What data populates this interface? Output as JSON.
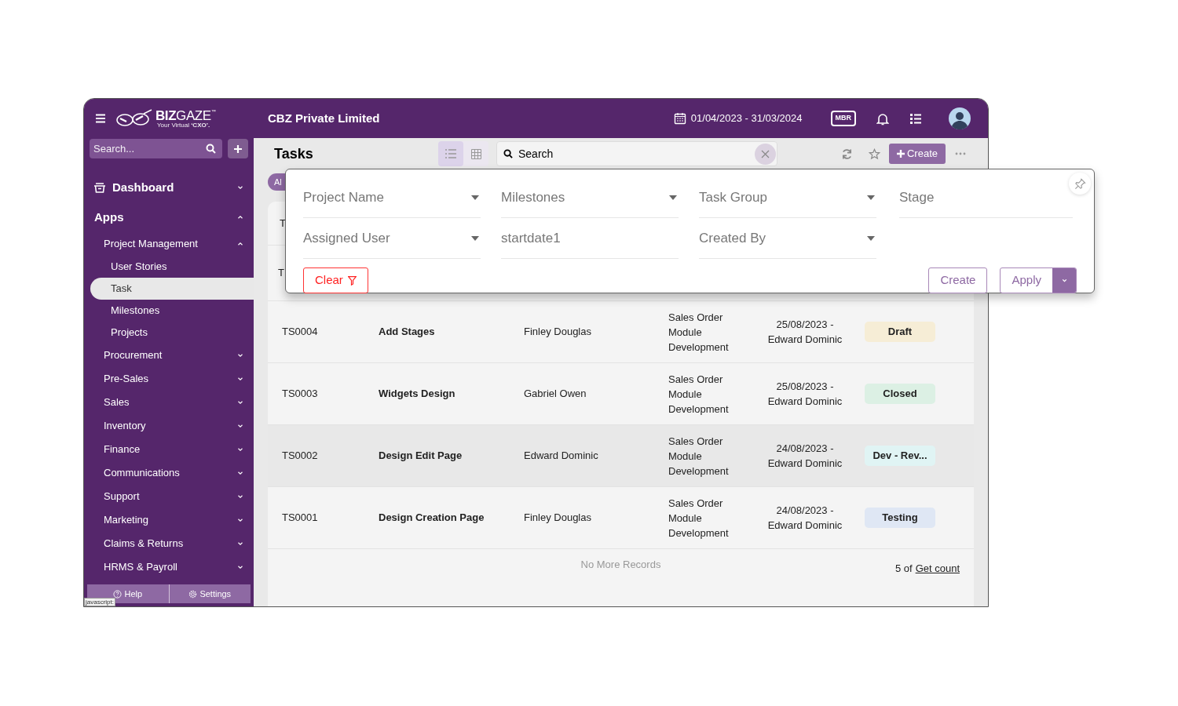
{
  "header": {
    "logo": {
      "brand": "**BIZ**GAZE",
      "trademark": "™",
      "tagline": "Your Virtual **‘CXO’.**"
    },
    "company": "CBZ Private Limited",
    "date_range": "01/04/2023 - 31/03/2024",
    "badge": "MBR"
  },
  "sidebar": {
    "search": {
      "placeholder": "Search..."
    },
    "items": [
      {
        "label": "Dashboard",
        "kind": "section",
        "expanded": false,
        "selected": false
      },
      {
        "label": "Apps",
        "kind": "heading",
        "expanded": true,
        "selected": false,
        "children": [
          {
            "label": "Project Management",
            "kind": "group",
            "expanded": true,
            "selected": false,
            "children": [
              {
                "label": "User Stories",
                "kind": "leaf",
                "selected": false
              },
              {
                "label": "Task",
                "kind": "leaf",
                "selected": true
              },
              {
                "label": "Milestones",
                "kind": "leaf",
                "selected": false
              },
              {
                "label": "Projects",
                "kind": "leaf",
                "selected": false
              }
            ]
          },
          {
            "label": "Procurement",
            "kind": "group",
            "expanded": false,
            "selected": false
          },
          {
            "label": "Pre-Sales",
            "kind": "group",
            "expanded": false,
            "selected": false
          },
          {
            "label": "Sales",
            "kind": "group",
            "expanded": false,
            "selected": false
          },
          {
            "label": "Inventory",
            "kind": "group",
            "expanded": false,
            "selected": false
          },
          {
            "label": "Finance",
            "kind": "group",
            "expanded": false,
            "selected": false
          },
          {
            "label": "Communications",
            "kind": "group",
            "expanded": false,
            "selected": false
          },
          {
            "label": "Support",
            "kind": "group",
            "expanded": false,
            "selected": false
          },
          {
            "label": "Marketing",
            "kind": "group",
            "expanded": false,
            "selected": false
          },
          {
            "label": "Claims & Returns",
            "kind": "group",
            "expanded": false,
            "selected": false
          },
          {
            "label": "HRMS & Payroll",
            "kind": "group",
            "expanded": false,
            "selected": false
          }
        ]
      }
    ],
    "footer": [
      {
        "label": "Help",
        "kind": "help"
      },
      {
        "label": "Settings",
        "kind": "settings"
      }
    ],
    "status_tip": "javascript:"
  },
  "toolbar": {
    "title": "Tasks",
    "views": [
      {
        "kind": "list",
        "selected": true
      },
      {
        "kind": "grid",
        "selected": false
      }
    ],
    "search": {
      "placeholder": "Search"
    },
    "create": "Create"
  },
  "filter_chip": "Al",
  "column_1_header": "T",
  "hidden_row_cell": "T",
  "rows": [
    {
      "id": "TS0004",
      "title": "Add Stages",
      "assignee": "Finley Douglas",
      "milestone": "Sales Order Module Development",
      "date": "25/08/2023 -",
      "creator": "Edward Dominic",
      "status": {
        "label": "Draft",
        "color": "#f6edd6"
      },
      "highlighted": false
    },
    {
      "id": "TS0003",
      "title": "Widgets Design",
      "assignee": "Gabriel Owen",
      "milestone": "Sales Order Module Development",
      "date": "25/08/2023 -",
      "creator": "Edward Dominic",
      "status": {
        "label": "Closed",
        "color": "#dcf0e4"
      },
      "highlighted": false
    },
    {
      "id": "TS0002",
      "title": "Design Edit Page",
      "assignee": "Edward Dominic",
      "milestone": "Sales Order Module Development",
      "date": "24/08/2023 -",
      "creator": "Edward Dominic",
      "status": {
        "label": "Dev - Rev...",
        "color": "#e0f4f4"
      },
      "highlighted": true
    },
    {
      "id": "TS0001",
      "title": "Design Creation Page",
      "assignee": "Finley Douglas",
      "milestone": "Sales Order Module Development",
      "date": "24/08/2023 -",
      "creator": "Edward Dominic",
      "status": {
        "label": "Testing",
        "color": "#dfe7f4"
      },
      "highlighted": false
    }
  ],
  "list_footer": {
    "message": "No More Records",
    "count": "5 of",
    "count_link": "Get count"
  },
  "filter_panel": {
    "fields": [
      {
        "placeholder": "Project Name",
        "dropdown": true
      },
      {
        "placeholder": "Milestones",
        "dropdown": true
      },
      {
        "placeholder": "Task Group",
        "dropdown": true
      },
      {
        "placeholder": "Stage",
        "dropdown": false
      },
      {
        "placeholder": "Assigned User",
        "dropdown": true
      },
      {
        "placeholder": "startdate1",
        "dropdown": false
      },
      {
        "placeholder": "Created By",
        "dropdown": true
      }
    ],
    "clear": "Clear",
    "create": "Create",
    "apply": "Apply"
  }
}
